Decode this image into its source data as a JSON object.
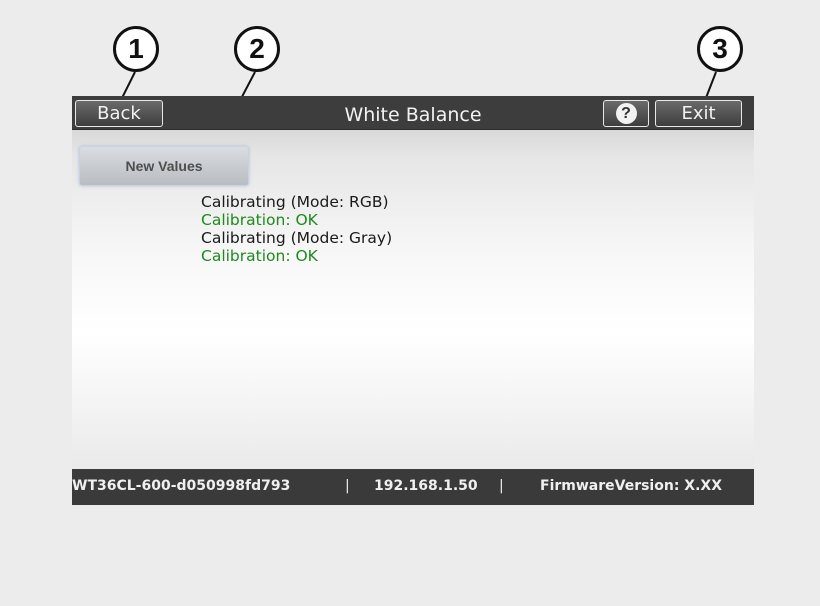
{
  "callouts": [
    "1",
    "2",
    "3"
  ],
  "titlebar": {
    "back_label": "Back",
    "title": "White Balance",
    "help_label": "?",
    "exit_label": "Exit"
  },
  "main": {
    "new_values_label": "New Values",
    "log": [
      {
        "text": "Calibrating (Mode: RGB)",
        "status": "info"
      },
      {
        "text": "Calibration: OK",
        "status": "ok"
      },
      {
        "text": "Calibrating (Mode: Gray)",
        "status": "info"
      },
      {
        "text": "Calibration: OK",
        "status": "ok"
      }
    ]
  },
  "statusbar": {
    "device_name": "WT36CL-600-d050998fd793",
    "separator": "|",
    "ip_address": "192.168.1.50",
    "firmware": "FirmwareVersion: X.XX"
  },
  "icons": {
    "help": "help-icon"
  },
  "colors": {
    "bar_background": "#3d3d3d",
    "ok_text": "#1e8a1e"
  }
}
